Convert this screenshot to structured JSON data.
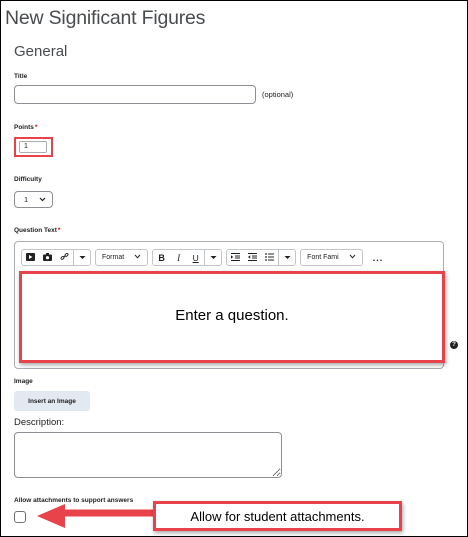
{
  "page": {
    "title": "New Significant Figures"
  },
  "section": {
    "title": "General"
  },
  "title_field": {
    "label": "Title",
    "value": "",
    "optional": "(optional)"
  },
  "points_field": {
    "label": "Points",
    "required": "*",
    "value": "1"
  },
  "difficulty_field": {
    "label": "Difficulty",
    "value": "1"
  },
  "question_field": {
    "label": "Question Text",
    "required": "*",
    "toolbar": {
      "format_label": "Format",
      "bold": "B",
      "italic": "I",
      "underline": "U",
      "font_family_label": "Font Fami",
      "more": "..."
    },
    "annotation_text": "Enter a question."
  },
  "image_field": {
    "label": "Image",
    "button_label": "Insert an Image"
  },
  "description_field": {
    "label": "Description:",
    "value": ""
  },
  "attachments_field": {
    "label": "Allow attachments to support answers",
    "checked": false,
    "annotation_text": "Allow for student attachments."
  },
  "colors": {
    "annotation_red": "#e8424a",
    "button_bg": "#e3e9f1"
  },
  "icons": [
    "play-video-icon",
    "camera-icon",
    "link-icon",
    "chevron-down-icon",
    "indent-icon",
    "outdent-icon",
    "bullet-list-icon",
    "help-icon",
    "arrow-left-icon"
  ]
}
